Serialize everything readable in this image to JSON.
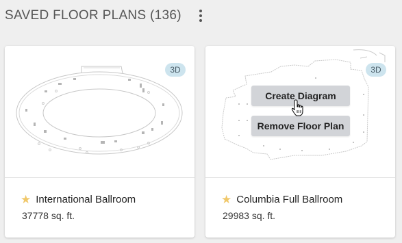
{
  "header": {
    "title": "SAVED FLOOR PLANS (136)",
    "menu_icon": "more-vertical-icon"
  },
  "floor_plans": [
    {
      "name": "International Ballroom",
      "size": "37778 sq. ft.",
      "badge": "3D",
      "starred": true
    },
    {
      "name": "Columbia Full Ballroom",
      "size": "29983 sq. ft.",
      "badge": "3D",
      "starred": true,
      "hover_menu": {
        "create_label": "Create Diagram",
        "remove_label": "Remove Floor Plan"
      }
    }
  ],
  "colors": {
    "background": "#efefef",
    "badge_bg": "#cde4ee",
    "star": "#f0c86a",
    "menu_button_bg": "#d2d4d8"
  }
}
